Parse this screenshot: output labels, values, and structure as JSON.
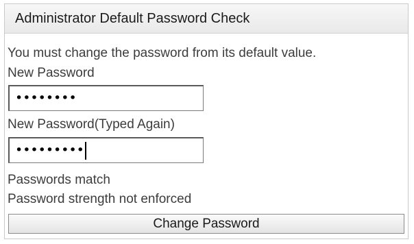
{
  "panel": {
    "title": "Administrator Default Password Check"
  },
  "form": {
    "instruction": "You must change the password from its default value.",
    "new_password_label": "New Password",
    "new_password_value": "••••••••",
    "confirm_password_label": "New Password(Typed Again)",
    "confirm_password_value": "•••••••••",
    "match_status": "Passwords match",
    "strength_status": "Password strength not enforced",
    "submit_label": "Change Password"
  }
}
